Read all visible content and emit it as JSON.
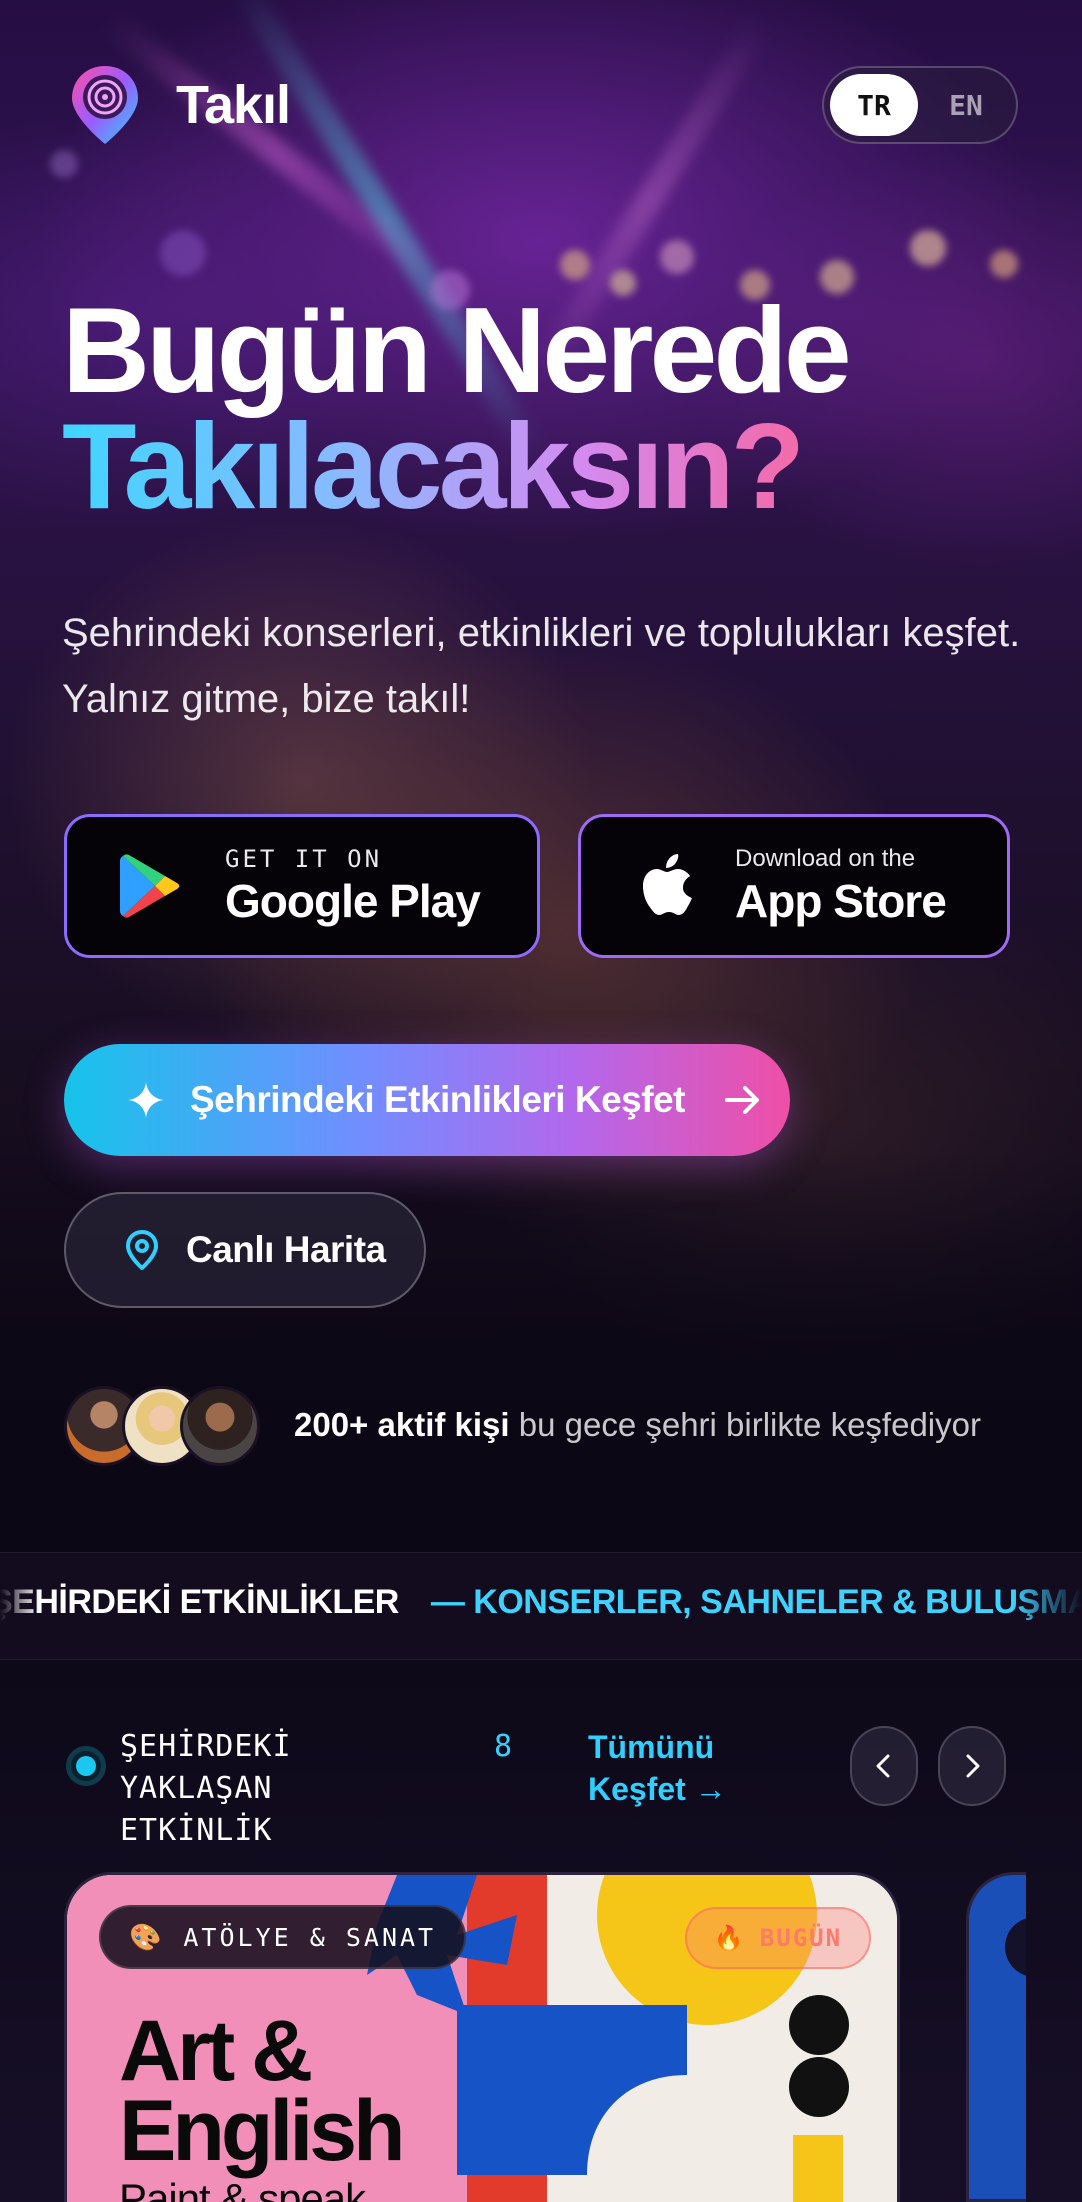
{
  "header": {
    "app_name": "Takıl",
    "languages": [
      {
        "code": "TR",
        "active": true
      },
      {
        "code": "EN",
        "active": false
      }
    ]
  },
  "hero": {
    "title_line1": "Bugün Nerede",
    "title_line2": "Takılacaksın?",
    "subtitle": "Şehrindeki konserleri, etkinlikleri ve toplulukları keşfet. Yalnız gitme, bize takıl!"
  },
  "stores": {
    "google_play": {
      "small": "GET IT ON",
      "big": "Google Play",
      "icon": "google-play-icon"
    },
    "app_store": {
      "small": "Download on the",
      "big": "App Store",
      "icon": "apple-icon"
    }
  },
  "cta": {
    "primary_label": "Şehrindeki Etkinlikleri Keşfet",
    "secondary_label": "Canlı Harita"
  },
  "social_proof": {
    "highlight": "200+ aktif kişi",
    "rest": " bu gece şehri birlikte keşfediyor"
  },
  "marquee": {
    "part1": "ŞEHİRDEKİ ETKİNLİKLER",
    "part2": "— KONSERLER, SAHNELER & BULUŞMALAR"
  },
  "upcoming": {
    "title": "ŞEHİRDEKİ YAKLAŞAN ETKİNLİK",
    "count": "8",
    "see_all": "Tümünü Keşfet →"
  },
  "event_card": {
    "category_emoji": "🎨",
    "category": "ATÖLYE & SANAT",
    "badge_emoji": "🔥",
    "badge": "BUGÜN",
    "title_line1": "Art &",
    "title_line2": "English",
    "subtitle": "Paint & speak"
  },
  "colors": {
    "accent_cyan": "#2fd0ff",
    "accent_pink": "#ef4fa6",
    "accent_purple": "#8d6bff",
    "background": "#0b0714"
  }
}
